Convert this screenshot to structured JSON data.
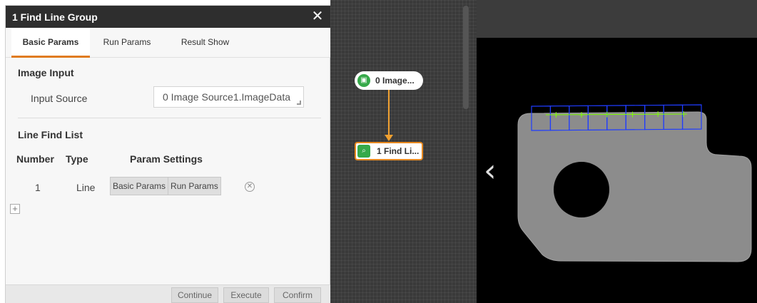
{
  "dialog": {
    "title": "1 Find Line Group",
    "close_glyph": "✕",
    "tabs": [
      {
        "label": "Basic Params",
        "active": true
      },
      {
        "label": "Run Params",
        "active": false
      },
      {
        "label": "Result Show",
        "active": false
      }
    ],
    "image_input": {
      "title": "Image Input",
      "source_label": "Input Source",
      "source_value": "0 Image Source1.ImageData"
    },
    "line_find": {
      "title": "Line Find List",
      "headers": {
        "number": "Number",
        "type": "Type",
        "param": "Param Settings"
      },
      "rows": [
        {
          "number": "1",
          "type": "Line",
          "basic_btn": "Basic Params",
          "run_btn": "Run Params"
        }
      ],
      "add_glyph": "+",
      "remove_glyph": "✕"
    },
    "footer": {
      "continue": "Continue",
      "execute": "Execute",
      "confirm": "Confirm"
    }
  },
  "flow": {
    "nodes": [
      {
        "label": "0 Image...",
        "icon": "image-icon"
      },
      {
        "label": "1 Find Li...",
        "icon": "find-line-icon"
      }
    ],
    "connector_color": "#f0a030"
  },
  "view": {
    "nav_glyph": "‹",
    "caliper_color": "#1f3cff",
    "point_color": "#7fff00",
    "part_color": "#8c8c8c"
  }
}
